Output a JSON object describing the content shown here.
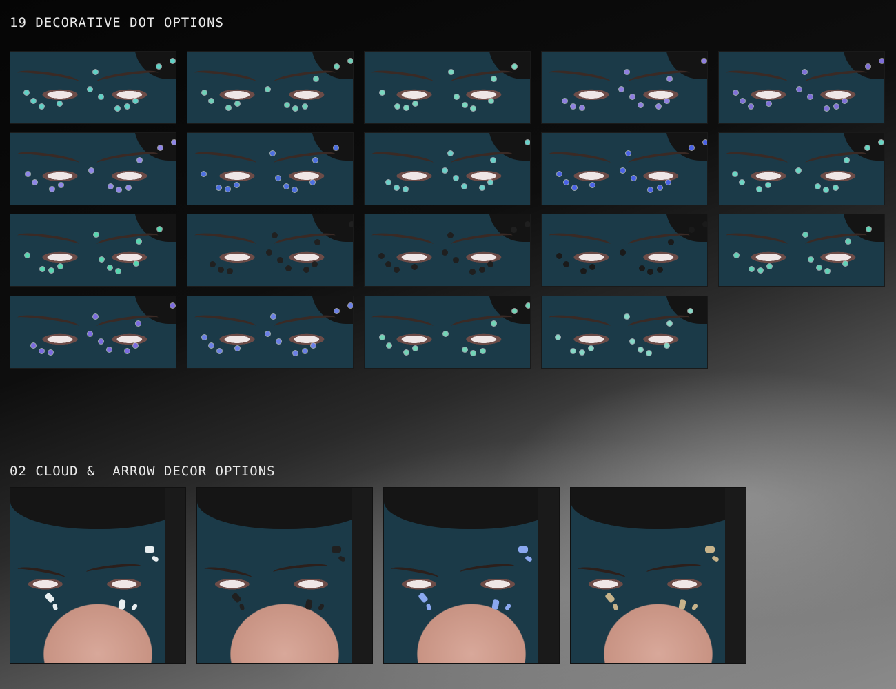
{
  "section_dots": {
    "heading": "19 DECORATIVE DOT OPTIONS",
    "tiles": [
      {
        "label": "dot-option-01",
        "dot_color": "#5fd1c5"
      },
      {
        "label": "dot-option-02",
        "dot_color": "#6fd0b8"
      },
      {
        "label": "dot-option-03",
        "dot_color": "#7ad7bf"
      },
      {
        "label": "dot-option-04",
        "dot_color": "#8f7fe0"
      },
      {
        "label": "dot-option-05",
        "dot_color": "#7f6fd8"
      },
      {
        "label": "dot-option-06",
        "dot_color": "#8f86e6"
      },
      {
        "label": "dot-option-07",
        "dot_color": "#4d6fe0"
      },
      {
        "label": "dot-option-08",
        "dot_color": "#6ad0c8"
      },
      {
        "label": "dot-option-09",
        "dot_color": "#4a62e6"
      },
      {
        "label": "dot-option-10",
        "dot_color": "#6bd6c4"
      },
      {
        "label": "dot-option-11",
        "dot_color": "#58d6b0"
      },
      {
        "label": "dot-option-12",
        "dot_color": "#202020"
      },
      {
        "label": "dot-option-13",
        "dot_color": "#1f1f1f"
      },
      {
        "label": "dot-option-14",
        "dot_color": "#1a1a1a"
      },
      {
        "label": "dot-option-15",
        "dot_color": "#62d1b6"
      },
      {
        "label": "dot-option-16",
        "dot_color": "#7c6be0"
      },
      {
        "label": "dot-option-17",
        "dot_color": "#6b7fe6"
      },
      {
        "label": "dot-option-18",
        "dot_color": "#72d4b6"
      },
      {
        "label": "dot-option-19",
        "dot_color": "#86d8c6"
      }
    ]
  },
  "section_cloud": {
    "heading": "02 CLOUD &  ARROW DECOR OPTIONS",
    "tiles": [
      {
        "label": "cloud-decor-white",
        "decor_color": "#e8eef0"
      },
      {
        "label": "arrow-decor-black",
        "decor_color": "#202020"
      },
      {
        "label": "cloud-decor-blue",
        "decor_color": "#8aa8f0"
      },
      {
        "label": "arrow-decor-gold",
        "decor_color": "#c7b38a"
      }
    ]
  }
}
